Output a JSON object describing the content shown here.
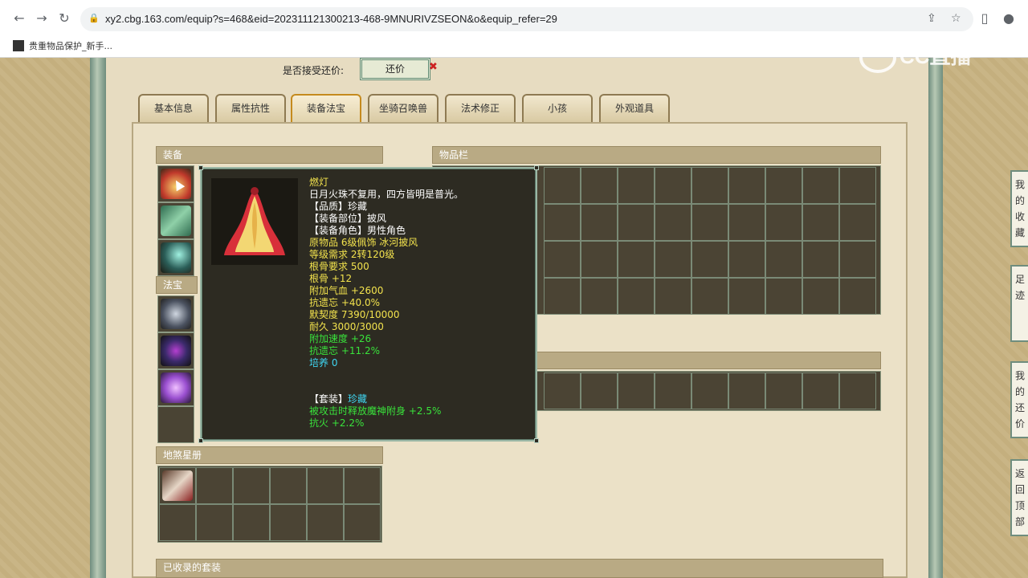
{
  "browser": {
    "url": "xy2.cbg.163.com/equip?s=468&eid=202311121300213-468-9MNURIVZSEON&o&equip_refer=29",
    "bookmark": "贵重物品保护_新手..."
  },
  "watermark": "CC直播",
  "haggle": {
    "label": "是否接受还价:",
    "button": "还价"
  },
  "tabs": [
    "基本信息",
    "属性抗性",
    "装备法宝",
    "坐骑召唤兽",
    "法术修正",
    "小孩",
    "外观道具"
  ],
  "sections": {
    "equip": "装备",
    "fabao": "法宝",
    "inventory": "物品栏",
    "disha": "地煞星册",
    "collected": "已收录的套装"
  },
  "tooltip": {
    "name": "燃灯",
    "desc": "日月火珠不复用，四方皆明是普光。",
    "quality": "【品质】珍藏",
    "slot": "【装备部位】披风",
    "role": "【装备角色】男性角色",
    "original": "原物品 6级佩饰 冰河披风",
    "level": "等级需求 2转120级",
    "bone_req": "根骨要求 500",
    "bone": "根骨 +12",
    "hp": "附加气血 +2600",
    "forget": "抗遗忘 +40.0%",
    "tacit": "默契度 7390/10000",
    "durability": "耐久 3000/3000",
    "speed": "附加速度 +26",
    "forget2": "抗遗忘 +11.2%",
    "cultivate": "培养 0",
    "set_prefix": "【套装】",
    "set_name": "珍藏",
    "set_effect": "被攻击时释放魔神附身 +2.5%",
    "fire": "抗火 +2.2%"
  },
  "side_buttons": [
    "我的收藏",
    "足迹",
    "我的还价",
    "返回顶部"
  ],
  "colors": {
    "yellow": "#f2e24d",
    "green": "#39e23b",
    "cyan": "#3fd6f2"
  }
}
